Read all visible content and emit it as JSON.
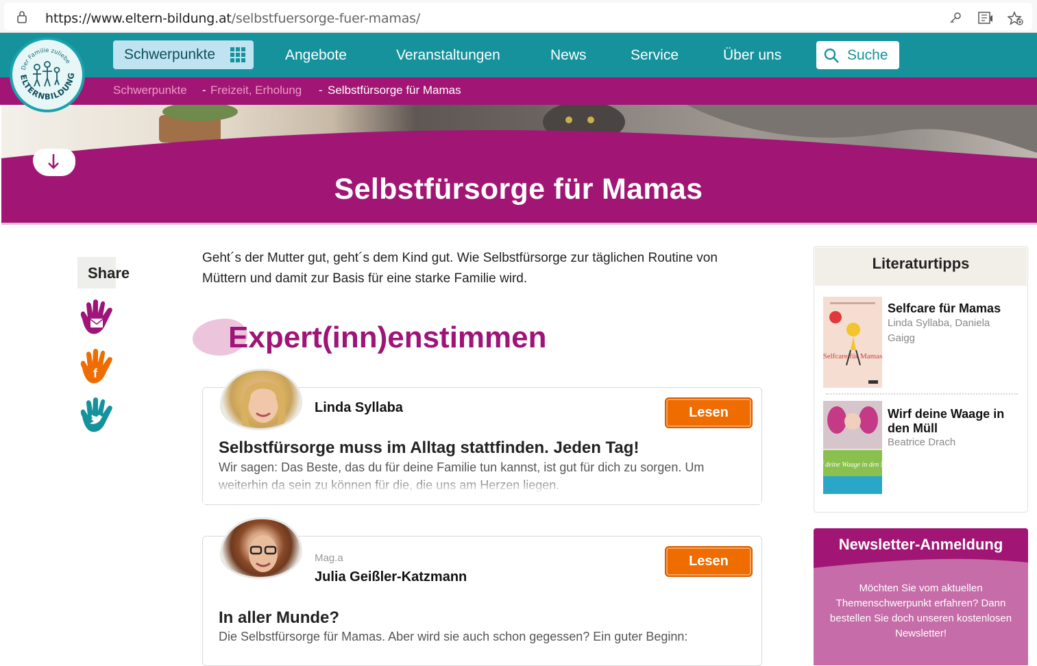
{
  "browser": {
    "url_host": "https://www.eltern-bildung.at",
    "url_path": "/selbstfuersorge-fuer-mamas/"
  },
  "logo": {
    "arc_text": "Der Familie zuliebe",
    "wordmark": "ELTERNBILDUNG"
  },
  "nav": {
    "items": [
      "Schwerpunkte",
      "Angebote",
      "Veranstaltungen",
      "News",
      "Service",
      "Über uns"
    ],
    "search_label": "Suche"
  },
  "breadcrumb": {
    "items": [
      "Schwerpunkte",
      "Freizeit, Erholung",
      "Selbstfürsorge für Mamas"
    ],
    "separator": "-"
  },
  "hero": {
    "title": "Selbstfürsorge für Mamas"
  },
  "share": {
    "label": "Share",
    "icons": [
      "email-hand-icon",
      "facebook-hand-icon",
      "twitter-hand-icon"
    ]
  },
  "intro": "Geht´s der Mutter gut, geht´s dem Kind gut. Wie Selbstfürsorge zur täglichen Routine von Müttern und damit zur Basis für eine starke Familie wird.",
  "section_title": "Expert(inn)enstimmen",
  "experts": [
    {
      "prefix": "",
      "name": "Linda Syllaba",
      "button": "Lesen",
      "heading": "Selbstfürsorge muss im Alltag stattfinden. Jeden Tag!",
      "text": "Wir sagen: Das Beste, das du für deine Familie tun kannst, ist gut für dich zu sorgen. Um weiterhin da sein zu können für die, die uns am Herzen liegen."
    },
    {
      "prefix": "Mag.a",
      "name": "Julia Geißler-Katzmann",
      "button": "Lesen",
      "heading": "In aller Munde?",
      "text": "Die Selbstfürsorge für Mamas. Aber wird sie auch schon gegessen? Ein guter Beginn:"
    }
  ],
  "sidebar": {
    "literature_title": "Literaturtipps",
    "books": [
      {
        "title": "Selfcare für Mamas",
        "authors": "Linda Syllaba, Daniela Gaigg",
        "cover_text": "Selfcare für Mamas"
      },
      {
        "title": "Wirf deine Waage in den Müll",
        "authors": "Beatrice Drach",
        "cover_text": "Wirf deine Waage in den Müll"
      }
    ],
    "newsletter_title": "Newsletter-Anmeldung",
    "newsletter_text": "Möchten Sie vom aktuellen Themenschwerpunkt erfahren? Dann bestellen Sie doch unseren kostenlosen Newsletter!"
  },
  "colors": {
    "teal": "#15929c",
    "magenta": "#a11674",
    "orange": "#ef6c00",
    "newsletter": "#c66ca9"
  }
}
